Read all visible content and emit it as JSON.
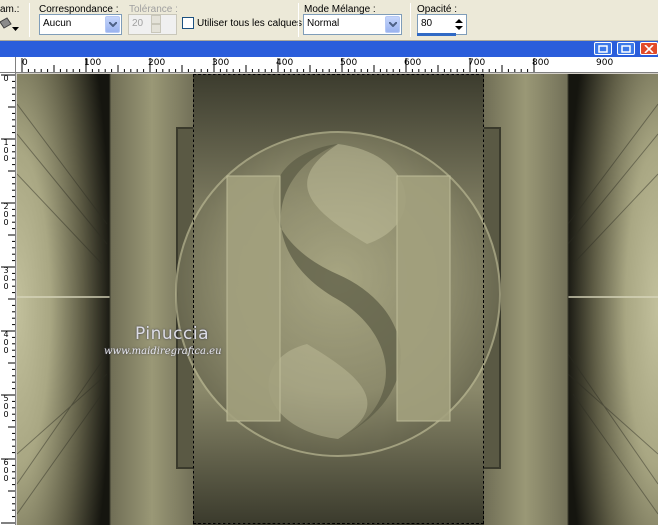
{
  "toolbar": {
    "truncated_label": "am.:",
    "correspondance": {
      "label": "Correspondance :",
      "value": "Aucun"
    },
    "tolerance": {
      "label": "Tolérance :",
      "value": "20"
    },
    "sample_merged": {
      "label": "Utiliser tous les calques",
      "checked": false
    },
    "blend_mode": {
      "label": "Mode Mélange :",
      "value": "Normal"
    },
    "opacity": {
      "label": "Opacité :",
      "value": "80",
      "level_percent": 80
    }
  },
  "ruler_top": [
    "0",
    "100",
    "200",
    "300",
    "400",
    "500",
    "600",
    "700",
    "800",
    "900"
  ],
  "ruler_left": [
    "0",
    "100",
    "200",
    "300",
    "400",
    "500",
    "600"
  ],
  "canvas": {
    "watermark_name": "Pinuccia",
    "watermark_url": "www.maidiregrafica.eu",
    "palette": {
      "light": "#b2b08a",
      "mid": "#8c8a6c",
      "dark": "#3c3c2e",
      "shadow": "#1a1a14"
    }
  },
  "icons": [
    "bucket-icon",
    "dropdown-arrow-icon",
    "spin-up-icon",
    "spin-down-icon",
    "maximize-icon",
    "close-icon"
  ]
}
